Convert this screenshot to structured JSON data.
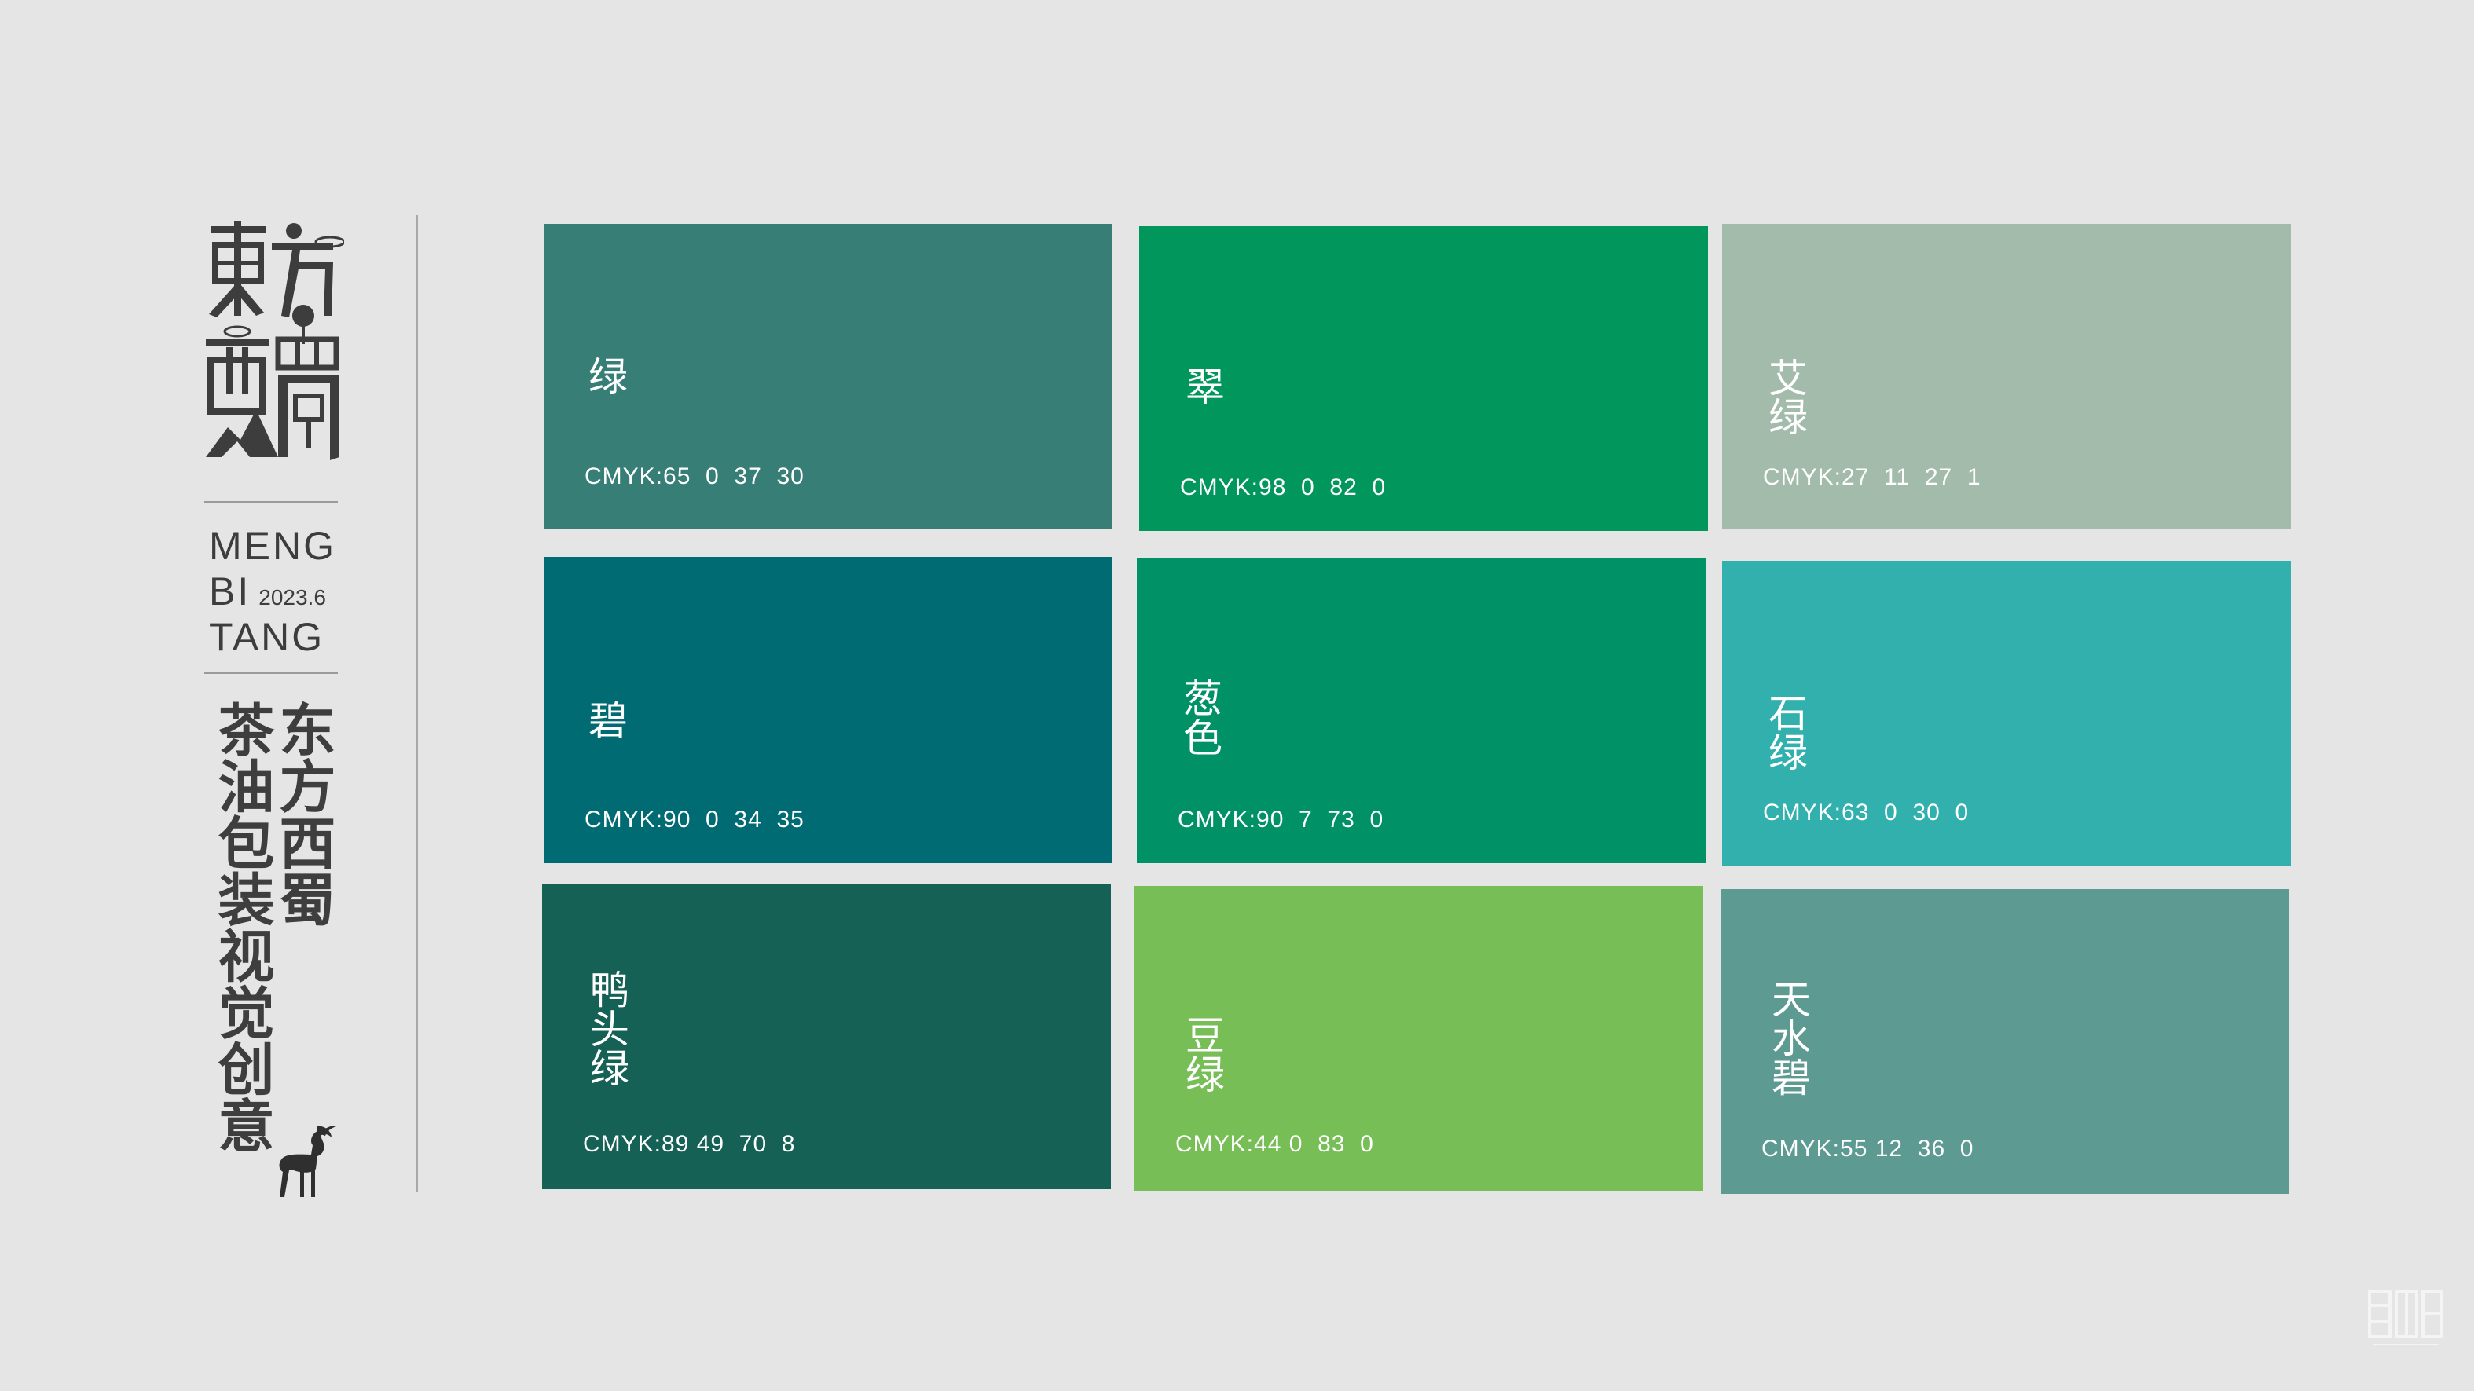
{
  "brand": {
    "logo_text": "東方西蜀",
    "line1": "MENG",
    "line2": "BI",
    "date": "2023.6",
    "line3": "TANG",
    "title_col_right": "东方西蜀",
    "title_col_left": "茶油包装视觉创意"
  },
  "swatches": [
    {
      "name": "绿",
      "cmyk": "CMYK:65  0  37  30",
      "color": "#377f76"
    },
    {
      "name": "翠",
      "cmyk": "CMYK:98  0  82  0",
      "color": "#00965c"
    },
    {
      "name": "艾绿",
      "cmyk": "CMYK:27  11  27  1",
      "color": "#a3bbab"
    },
    {
      "name": "碧",
      "cmyk": "CMYK:90  0  34  35",
      "color": "#006b72"
    },
    {
      "name": "葱色",
      "cmyk": "CMYK:90  7  73  0",
      "color": "#009166"
    },
    {
      "name": "石绿",
      "cmyk": "CMYK:63  0  30  0",
      "color": "#31b0ae"
    },
    {
      "name": "鸭头绿",
      "cmyk": "CMYK:89 49  70  8",
      "color": "#166155"
    },
    {
      "name": "豆绿",
      "cmyk": "CMYK:44 0  83  0",
      "color": "#78be57"
    },
    {
      "name": "天水碧",
      "cmyk": "CMYK:55 12  36  0",
      "color": "#5d9a91"
    }
  ],
  "icons": {
    "logo": "dongfang-xishu-logo",
    "deer": "deer-icon",
    "watermark": "watermark-seal-icon"
  }
}
